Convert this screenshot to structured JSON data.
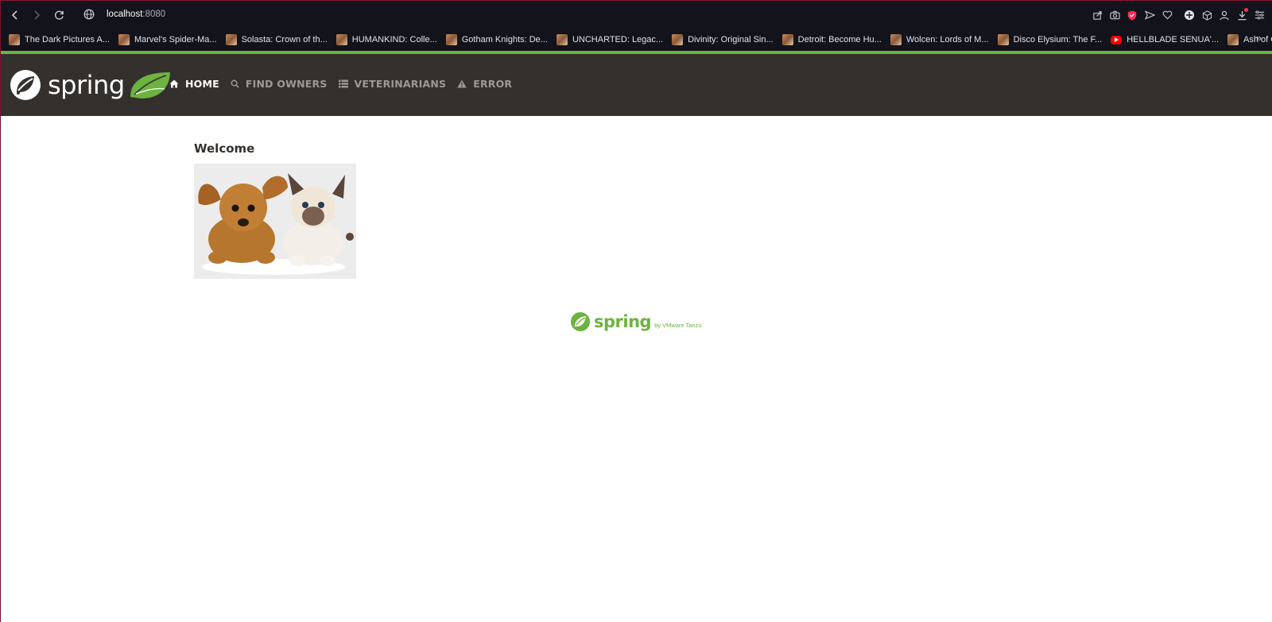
{
  "browser": {
    "address": {
      "host": "localhost",
      "port": ":8080"
    },
    "bookmarks": [
      {
        "label": "The Dark Pictures A...",
        "icon": "game-icon"
      },
      {
        "label": "Marvel's Spider-Ma...",
        "icon": "game-icon"
      },
      {
        "label": "Solasta: Crown of th...",
        "icon": "game-icon"
      },
      {
        "label": "HUMANKIND: Colle...",
        "icon": "game-icon"
      },
      {
        "label": "Gotham Knights: De...",
        "icon": "game-icon"
      },
      {
        "label": "UNCHARTED: Legac...",
        "icon": "game-icon"
      },
      {
        "label": "Divinity: Original Sin...",
        "icon": "game-icon"
      },
      {
        "label": "Detroit: Become Hu...",
        "icon": "game-icon"
      },
      {
        "label": "Wolcen: Lords of M...",
        "icon": "game-icon"
      },
      {
        "label": "Disco Elysium: The F...",
        "icon": "game-icon"
      },
      {
        "label": "HELLBLADE SENUA'...",
        "icon": "youtube-icon"
      },
      {
        "label": "Ash of Gods: The W...",
        "icon": "game-icon"
      }
    ],
    "more_label": "»"
  },
  "app": {
    "logo_text": "spring",
    "nav": [
      {
        "label": "HOME",
        "icon": "home-icon",
        "active": true
      },
      {
        "label": "FIND OWNERS",
        "icon": "search-icon",
        "active": false
      },
      {
        "label": "VETERINARIANS",
        "icon": "list-icon",
        "active": false
      },
      {
        "label": "ERROR",
        "icon": "warning-icon",
        "active": false
      }
    ],
    "page_title": "Welcome",
    "image_alt": "pets",
    "footer": {
      "logo_text": "spring",
      "sub": "by VMware Tanzu"
    }
  },
  "colors": {
    "accent": "#6db33f",
    "navbar": "#34302d",
    "chrome": "#13131b"
  }
}
